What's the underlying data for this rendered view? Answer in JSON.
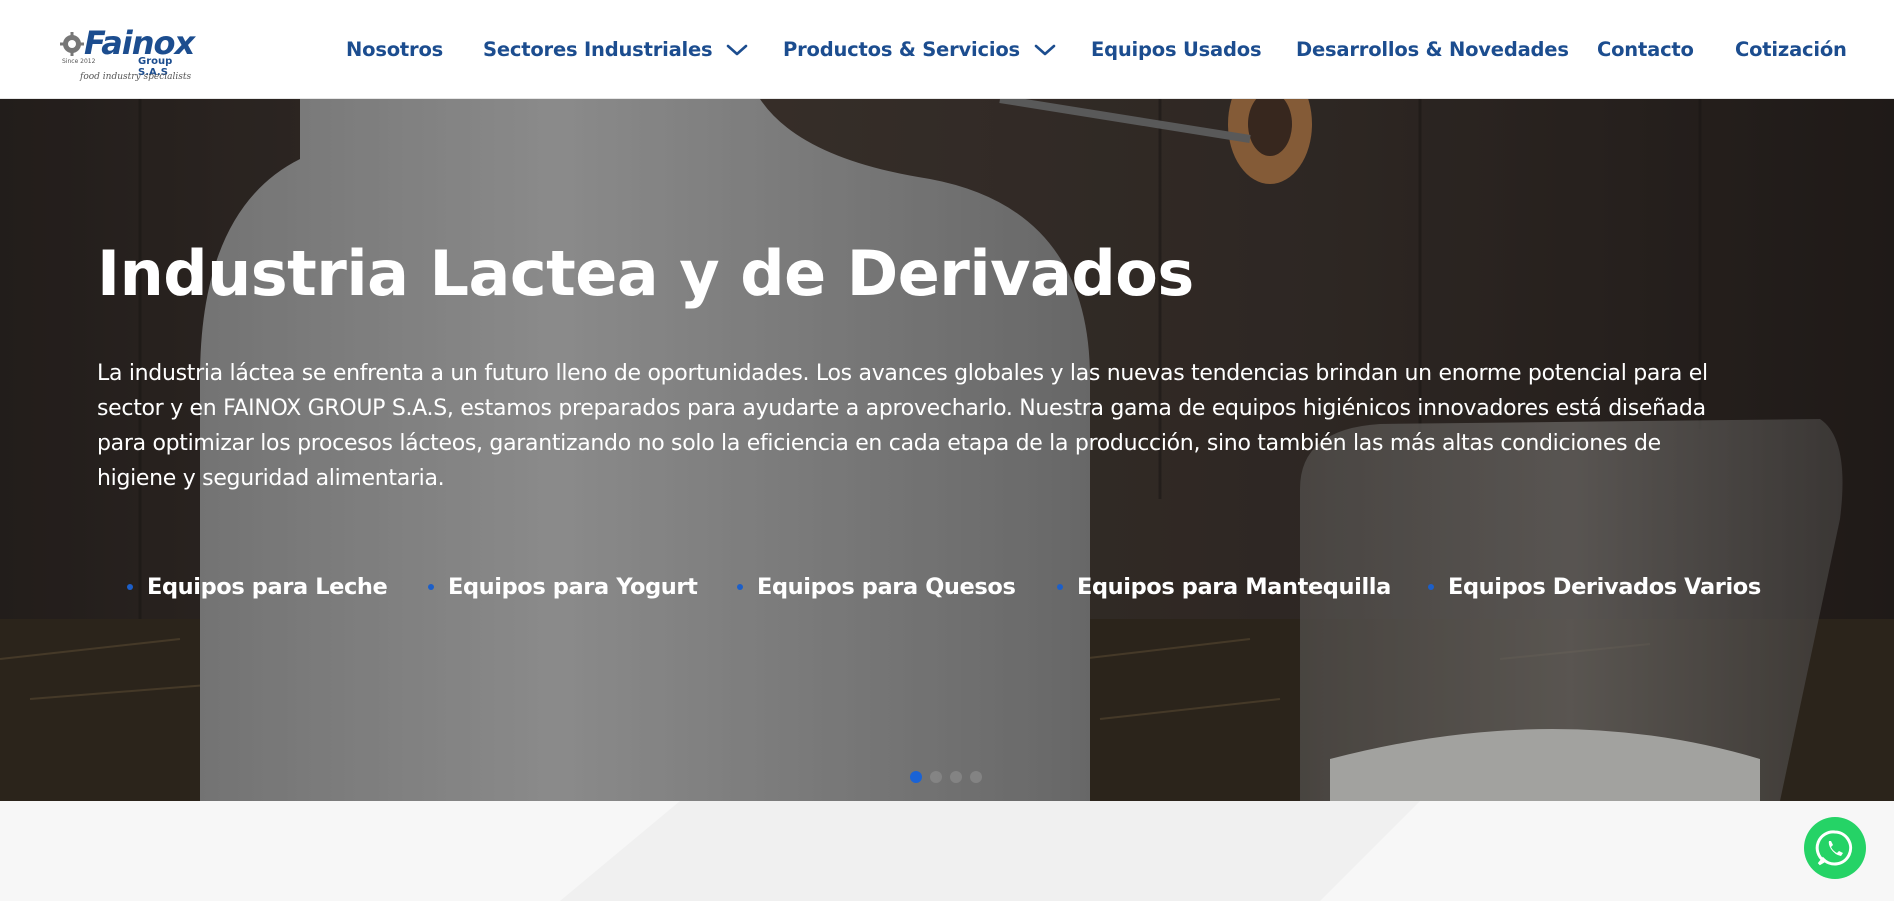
{
  "header": {
    "logo": {
      "brand": "Fainox",
      "group": "Group S.A.S",
      "tagline": "food industry specialists",
      "since": "Since 2012"
    },
    "nav": [
      {
        "label": "Nosotros",
        "has_dropdown": false
      },
      {
        "label": "Sectores Industriales",
        "has_dropdown": true
      },
      {
        "label": "Productos & Servicios",
        "has_dropdown": true
      },
      {
        "label": "Equipos Usados",
        "has_dropdown": false
      },
      {
        "label": "Desarrollos & Novedades",
        "has_dropdown": false
      },
      {
        "label": "Contacto",
        "has_dropdown": false
      },
      {
        "label": "Cotización",
        "has_dropdown": false
      }
    ]
  },
  "hero": {
    "title": "Industria Lactea y de Derivados",
    "text_lines": [
      "La industria láctea se enfrenta a un futuro lleno de oportunidades. Los avances globales y las nuevas tendencias brindan un enorme potencial para el",
      "sector y en FAINOX GROUP S.A.S, estamos preparados para ayudarte a aprovecharlo. Nuestra gama de equipos higiénicos innovadores está diseñada",
      "para optimizar los procesos lácteos, garantizando no solo la eficiencia en cada etapa de la producción, sino también las más altas condiciones de",
      "higiene y seguridad alimentaria."
    ],
    "links": [
      "Equipos para Leche",
      "Equipos para Yogurt",
      "Equipos para Quesos",
      "Equipos para Mantequilla",
      "Equipos Derivados Varios"
    ],
    "slides_total": 4,
    "active_slide": 1
  },
  "colors": {
    "brand_blue": "#1c4d8f",
    "bullet_blue": "#1c5fc9",
    "active_dot": "#1a63d6",
    "whatsapp_green": "#25d366"
  },
  "icons": {
    "dropdown": "chevron-down-icon",
    "whatsapp": "whatsapp-icon",
    "logo": "gear-icon"
  }
}
